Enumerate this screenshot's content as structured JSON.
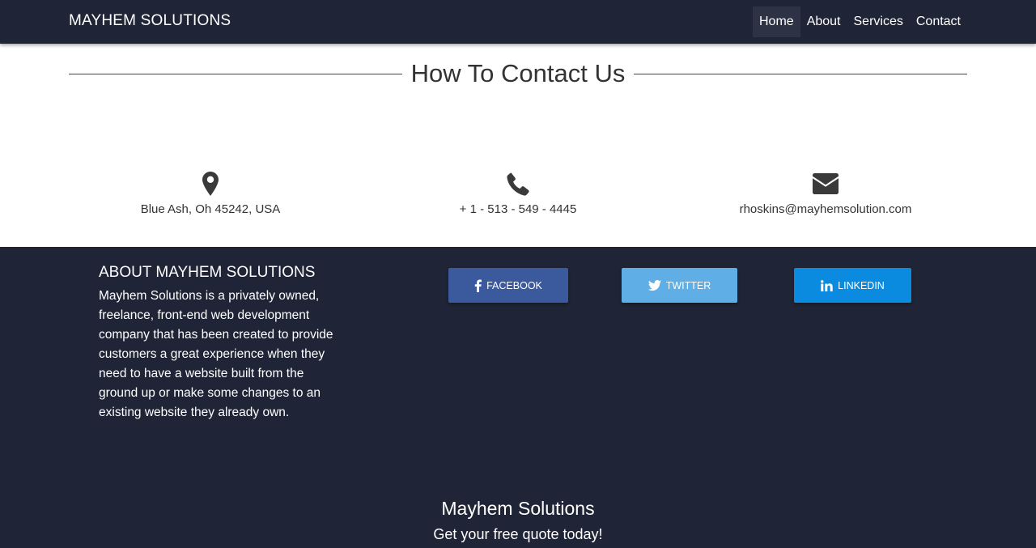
{
  "navbar": {
    "brand": "MAYHEM SOLUTIONS",
    "links": [
      {
        "label": "Home",
        "active": true
      },
      {
        "label": "About",
        "active": false
      },
      {
        "label": "Services",
        "active": false
      },
      {
        "label": "Contact",
        "active": false
      }
    ]
  },
  "contact": {
    "title": "How To Contact Us",
    "items": [
      {
        "icon": "map-marker-icon",
        "text": "Blue Ash, Oh 45242, USA"
      },
      {
        "icon": "phone-icon",
        "text": "+ 1 - 513 - 549 - 4445"
      },
      {
        "icon": "envelope-icon",
        "text": "rhoskins@mayhemsolution.com"
      }
    ]
  },
  "footer": {
    "about_title": "ABOUT MAYHEM SOLUTIONS",
    "about_text": "Mayhem Solutions is a privately owned, freelance, front-end web development company that has been created to provide customers a great experience when they need to have a website built from the ground up or make some changes to an existing website they already own.",
    "social": [
      {
        "label": "FACEBOOK",
        "icon": "facebook-icon",
        "color": "#3b5a9e"
      },
      {
        "label": "TWITTER",
        "icon": "twitter-icon",
        "color": "#5faee6"
      },
      {
        "label": "LINKEDIN",
        "icon": "linkedin-icon",
        "color": "#0a8bdf"
      }
    ],
    "brand": "Mayhem Solutions",
    "tagline": "Get your free quote today!"
  },
  "colors": {
    "navbar_bg": "#1f2436",
    "footer_bg": "#1f2436",
    "active_nav_bg": "#2d3344"
  }
}
